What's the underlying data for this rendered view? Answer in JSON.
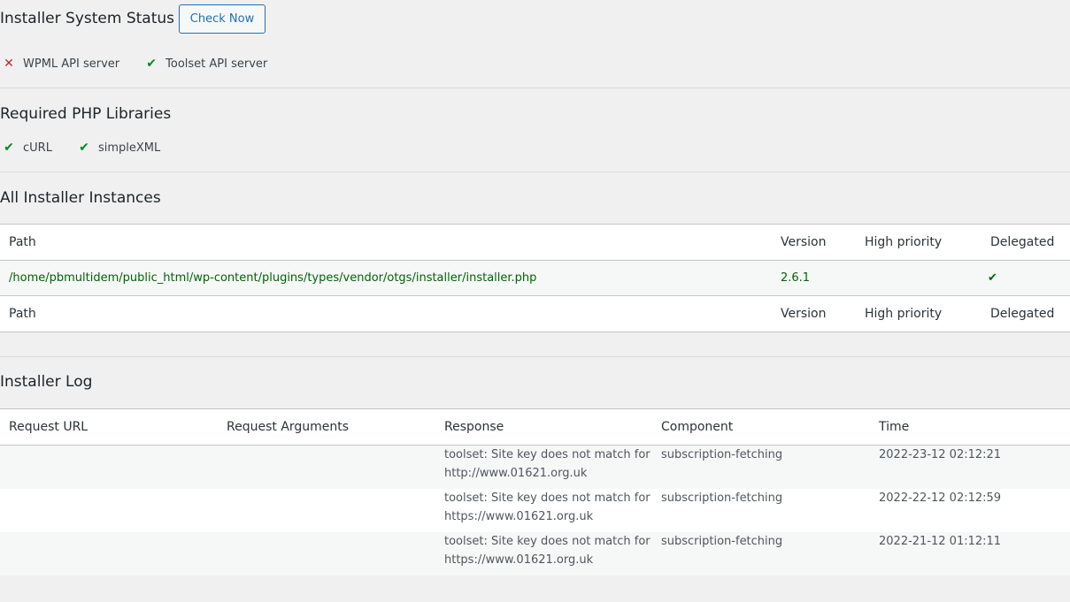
{
  "status": {
    "title": "Installer System Status",
    "check_now": "Check Now",
    "items": [
      {
        "label": "WPML API server",
        "state": "error",
        "icon": "x-icon"
      },
      {
        "label": "Toolset API server",
        "state": "ok",
        "icon": "checkmark-icon"
      }
    ]
  },
  "libraries": {
    "title": "Required PHP Libraries",
    "items": [
      {
        "label": "cURL",
        "icon": "checkmark-icon"
      },
      {
        "label": "simpleXML",
        "icon": "checkmark-icon"
      }
    ]
  },
  "instances": {
    "title": "All Installer Instances",
    "columns": [
      "Path",
      "Version",
      "High priority",
      "Delegated"
    ],
    "rows": [
      {
        "path": "/home/pbmultidem/public_html/wp-content/plugins/types/vendor/otgs/installer/installer.php",
        "version": "2.6.1",
        "high_priority": "",
        "delegated": "✔"
      }
    ]
  },
  "log": {
    "title": "Installer Log",
    "columns": [
      "Request URL",
      "Request Arguments",
      "Response",
      "Component",
      "Time"
    ],
    "rows": [
      {
        "url": "",
        "args": "",
        "response_line1": "toolset: Site key does not match for",
        "response_line2": "http://www.01621.org.uk",
        "component": "subscription-fetching",
        "time": "2022-23-12 02:12:21"
      },
      {
        "url": "",
        "args": "",
        "response_line1": "toolset: Site key does not match for",
        "response_line2": "https://www.01621.org.uk",
        "component": "subscription-fetching",
        "time": "2022-22-12 02:12:59"
      },
      {
        "url": "",
        "args": "",
        "response_line1": "toolset: Site key does not match for",
        "response_line2": "https://www.01621.org.uk",
        "component": "subscription-fetching",
        "time": "2022-21-12 01:12:11"
      }
    ]
  },
  "colors": {
    "ok": "#008a20",
    "error": "#b32d2e",
    "accent": "#2271b1",
    "path_green": "#006505"
  }
}
